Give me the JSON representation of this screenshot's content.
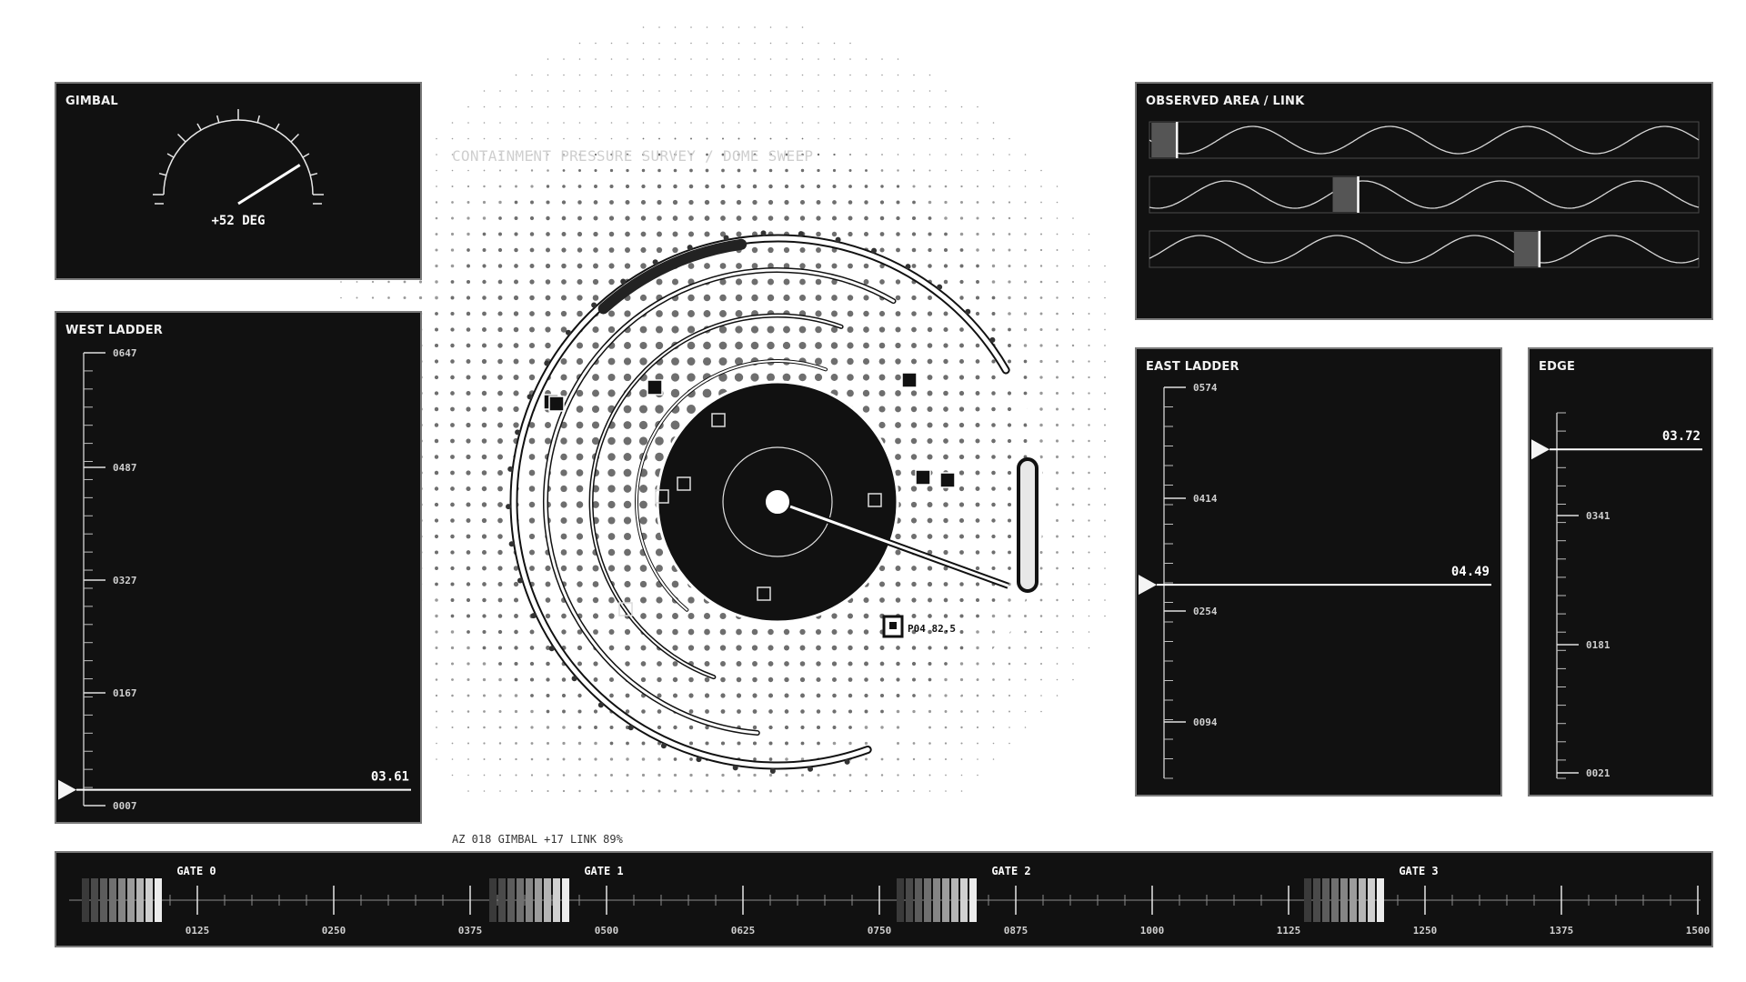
{
  "gimbal": {
    "title": "GIMBAL",
    "readout": "+52 DEG",
    "angle_deg": 52
  },
  "west_ladder": {
    "title": "WEST LADDER",
    "labels": [
      "0647",
      "0487",
      "0327",
      "0167",
      "0007"
    ],
    "value": "03.61",
    "level": 0.965
  },
  "observed": {
    "title": "OBSERVED AREA / LINK",
    "tracks": [
      {
        "marker": 0.05
      },
      {
        "marker": 0.38
      },
      {
        "marker": 0.71
      }
    ]
  },
  "east_ladder": {
    "title": "EAST LADDER",
    "labels": [
      "0574",
      "0414",
      "0254",
      "0094"
    ],
    "value": "04.49",
    "level": 0.505
  },
  "edge": {
    "title": "EDGE",
    "labels": [
      "0341",
      "0181",
      "0021"
    ],
    "value": "03.72",
    "level": 0.1
  },
  "dome": {
    "caption": "CONTAINMENT PRESSURE SURVEY / DOME SWEEP",
    "status": "AZ 018   GIMBAL +17   LINK 89%",
    "probe_label": "P04 82.5",
    "sweep_angle_deg": 20
  },
  "gates": {
    "labels": [
      "GATE 0",
      "GATE 1",
      "GATE 2",
      "GATE 3"
    ],
    "scale": [
      "0125",
      "0250",
      "0375",
      "0500",
      "0625",
      "0750",
      "0875",
      "1000",
      "1125",
      "1250",
      "1375",
      "1500"
    ]
  },
  "colors": {
    "panel_bg": "#111111",
    "panel_border": "#7a7a7a",
    "ink": "#f2f2f2",
    "dot": "#6e6e6e"
  }
}
